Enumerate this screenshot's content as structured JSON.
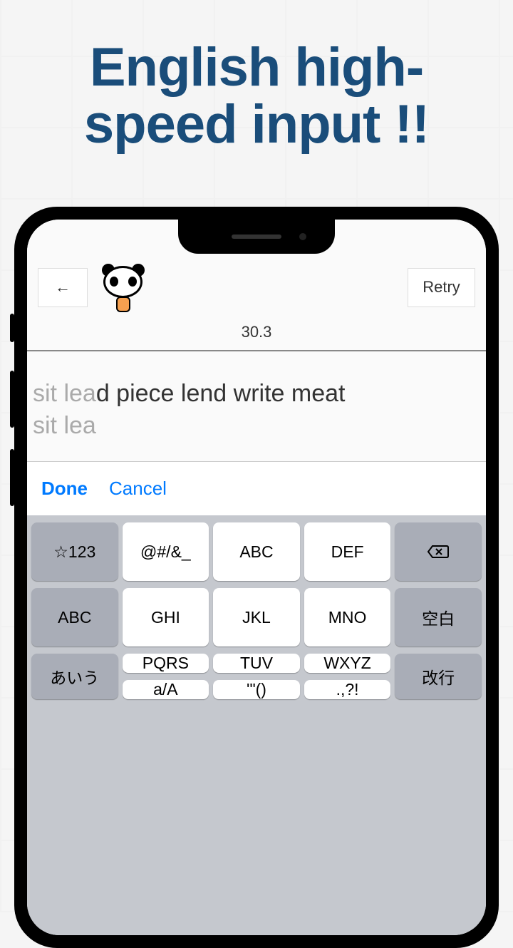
{
  "headline": "English high-speed input !!",
  "header": {
    "back_arrow": "←",
    "retry_label": "Retry",
    "timer": "30.3"
  },
  "typing": {
    "typed_prefix": "sit lea",
    "remaining_text": "d piece lend write meat",
    "input_value": "sit lea"
  },
  "actions": {
    "done": "Done",
    "cancel": "Cancel"
  },
  "keyboard": {
    "row1": {
      "k1": "☆123",
      "k2": "@#/&_",
      "k3": "ABC",
      "k4": "DEF"
    },
    "row2": {
      "k1": "ABC",
      "k2": "GHI",
      "k3": "JKL",
      "k4": "MNO",
      "k5": "空白"
    },
    "row3": {
      "k2": "PQRS",
      "k3": "TUV",
      "k4": "WXYZ"
    },
    "row4": {
      "k1": "あいう",
      "k2": "a/A",
      "k3": "'\"()",
      "k4": ".,?!",
      "k5": "改行"
    }
  }
}
